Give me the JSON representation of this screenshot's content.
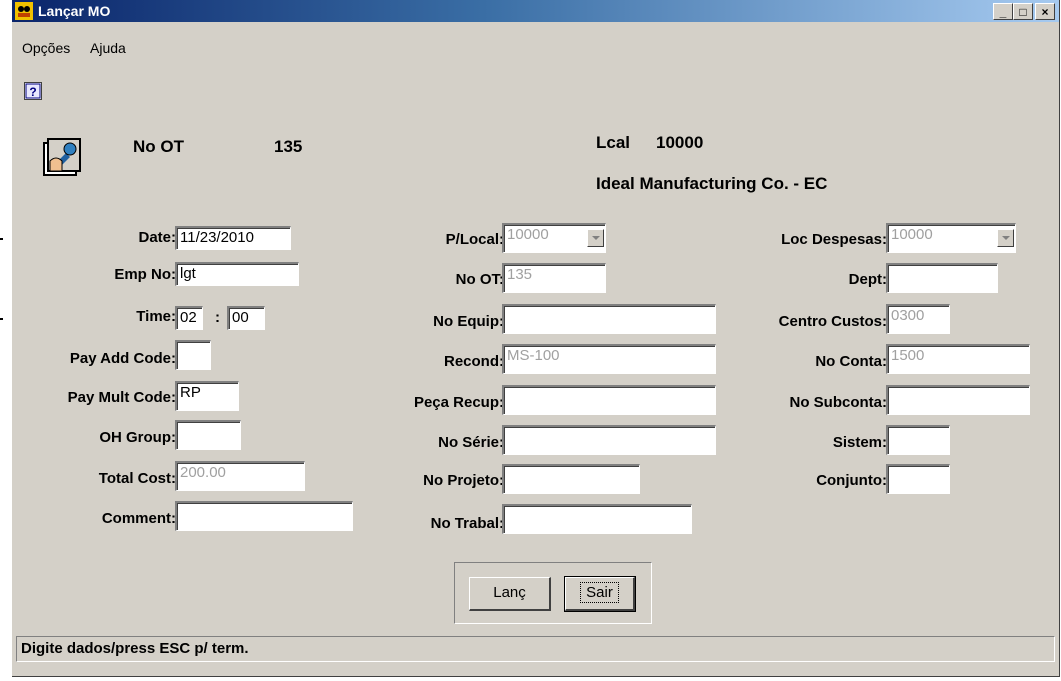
{
  "window": {
    "title": "Lançar MO",
    "minimize": "_",
    "maximize": "□",
    "close": "×"
  },
  "menu": {
    "options": "Opções",
    "help": "Ajuda"
  },
  "header": {
    "ot_label": "No OT",
    "ot_value": "135",
    "local_label": "Lcal",
    "local_value": "10000",
    "company": "Ideal Manufacturing Co. - EC"
  },
  "left": {
    "date_label": "Date:",
    "date_value": "11/23/2010",
    "emp_label": "Emp No:",
    "emp_value": "lgt",
    "time_label": "Time:",
    "time_hours": "02",
    "time_sep": ":",
    "time_minutes": "00",
    "payadd_label": "Pay Add Code:",
    "payadd_value": "",
    "paymult_label": "Pay Mult Code:",
    "paymult_value": "RP",
    "ohgroup_label": "OH Group:",
    "ohgroup_value": "",
    "totalcost_label": "Total Cost:",
    "totalcost_value": "200.00",
    "comment_label": "Comment:",
    "comment_value": ""
  },
  "middle": {
    "plocal_label": "P/Local:",
    "plocal_value": "10000",
    "not_label": "No OT:",
    "not_value": "135",
    "equip_label": "No Equip:",
    "equip_value": "",
    "recond_label": "Recond:",
    "recond_value": "MS-100",
    "peca_label": "Peça Recup:",
    "peca_value": "",
    "serie_label": "No Série:",
    "serie_value": "",
    "projeto_label": "No Projeto:",
    "projeto_value": "",
    "trabal_label": "No Trabal:",
    "trabal_value": ""
  },
  "right": {
    "locdesp_label": "Loc Despesas:",
    "locdesp_value": "10000",
    "dept_label": "Dept:",
    "dept_value": "",
    "centro_label": "Centro Custos:",
    "centro_value": "0300",
    "conta_label": "No Conta:",
    "conta_value": "1500",
    "subconta_label": "No Subconta:",
    "subconta_value": "",
    "sistem_label": "Sistem:",
    "sistem_value": "",
    "conjunto_label": "Conjunto:",
    "conjunto_value": ""
  },
  "buttons": {
    "lanc": "Lanç",
    "sair": "Sair"
  },
  "status": "Digite dados/press ESC p/ term."
}
